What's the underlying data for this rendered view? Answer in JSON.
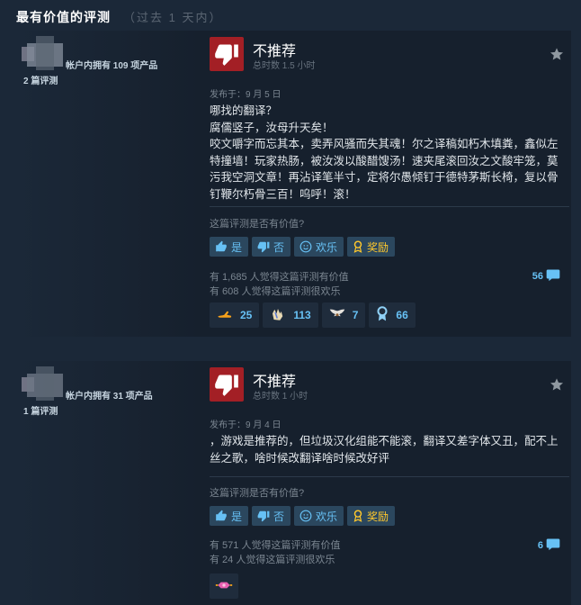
{
  "header": {
    "title": "最有价值的评测",
    "subtitle": "（过去 1 天内）"
  },
  "icons": {
    "thumbs_down": "thumbs-down-icon",
    "star": "star-icon",
    "comment": "comment-icon"
  },
  "colors": {
    "accent": "#67c1f5",
    "negative": "#a31f25",
    "background": "#1b2838",
    "card": "#16202d"
  },
  "reviews": [
    {
      "author": {
        "owned": "帐户内拥有 109 项产品",
        "reviews": "2 篇评测"
      },
      "verdict": "不推荐",
      "hours": "总时数 1.5 小时",
      "posted": "发布于：9 月 5 日",
      "body": "哪找的翻译？\n腐儒竖子，汝母升天矣！\n咬文嚼字而忘其本，卖弄风骚而失其魂！尔之译稿如朽木填粪，鑫似左特撞墙！玩家热肠，被汝泼以酸醋馊汤！速夹尾滚回汝之文酸牢笼，莫污我空洞文章！再沾译笔半寸，定将尔愚倾钉于德特茅斯长椅，复以骨钉鞭尔朽骨三百！呜呼！滚！",
      "helpful_question": "这篇评测是否有价值?",
      "buttons": {
        "yes": "是",
        "no": "否",
        "funny": "欢乐",
        "award": "奖励"
      },
      "helpful_count": "有 1,685 人觉得这篇评测有价值",
      "funny_count": "有 608 人觉得这篇评测很欢乐",
      "comments": "56",
      "awards": [
        {
          "icon": "flexing-arm-icon",
          "count": "25"
        },
        {
          "icon": "clapping-hands-icon",
          "count": "113"
        },
        {
          "icon": "winged-emblem-icon",
          "count": "7"
        },
        {
          "icon": "medal-icon",
          "count": "66"
        }
      ]
    },
    {
      "author": {
        "owned": "帐户内拥有 31 项产品",
        "reviews": "1 篇评测"
      },
      "verdict": "不推荐",
      "hours": "总时数 1 小时",
      "posted": "发布于：9 月 4 日",
      "body": "，游戏是推荐的，但垃圾汉化组能不能滚，翻译又差字体又丑，配不上丝之歌，啥时候改翻译啥时候改好评",
      "helpful_question": "这篇评测是否有价值?",
      "buttons": {
        "yes": "是",
        "no": "否",
        "funny": "欢乐",
        "award": "奖励"
      },
      "helpful_count": "有 571 人觉得这篇评测有价值",
      "funny_count": "有 24 人觉得这篇评测很欢乐",
      "comments": "6",
      "awards": [
        {
          "icon": "pink-gem-icon",
          "count": ""
        }
      ]
    }
  ]
}
